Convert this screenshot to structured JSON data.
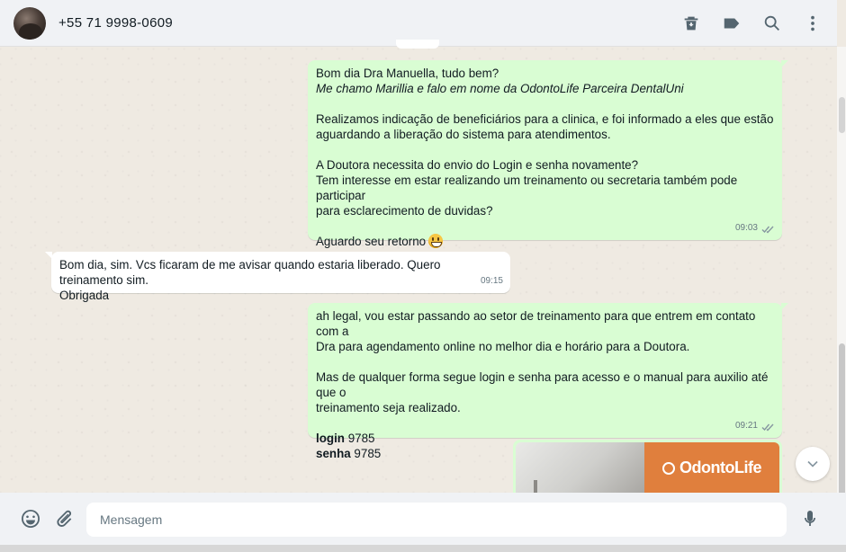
{
  "header": {
    "contact_name": "+55 71 9998-0609",
    "icons": [
      "delete-icon",
      "label-icon",
      "search-icon",
      "menu-icon"
    ]
  },
  "messages": [
    {
      "direction": "outgoing",
      "lines": [
        "Bom dia Dra Manuella, tudo bem?",
        "Me chamo Marillia e falo em nome da OdontoLife Parceira DentalUni",
        "",
        "Realizamos indicação de beneficiários para a clinica, e foi informado a eles que estão",
        "aguardando a liberação do sistema para atendimentos.",
        "",
        "A Doutora necessita do envio do Login e senha novamente?",
        "Tem interesse em estar realizando um treinamento ou secretaria também pode participar",
        "para esclarecimento de duvidas?",
        "",
        "Aguardo seu retorno"
      ],
      "time": "09:03"
    },
    {
      "direction": "incoming",
      "lines": [
        "Bom dia, sim. Vcs ficaram de me avisar quando estaria liberado. Quero treinamento sim.",
        "Obrigada"
      ],
      "time": "09:15"
    },
    {
      "direction": "outgoing",
      "lines": [
        "ah legal, vou estar passando ao setor de treinamento para que entrem em contato com a",
        "Dra para agendamento online no melhor dia e horário para a Doutora.",
        "",
        "Mas de qualquer forma segue login e senha para acesso e o manual para auxilio até que o",
        "treinamento seja realizado.",
        ""
      ],
      "login_label": "login",
      "login_value": " 9785",
      "senha_label": "senha",
      "senha_value": " 9785",
      "time": "09:21"
    }
  ],
  "image_message": {
    "logo_text": "OdontoLife",
    "brand_color": "#e07f3d"
  },
  "footer": {
    "placeholder": "Mensagem",
    "icons": [
      "emoji-icon",
      "attach-icon",
      "microphone-icon"
    ]
  },
  "colors": {
    "outgoing_bubble": "#d9fdd3",
    "incoming_bubble": "#ffffff",
    "chat_background": "#efeae2",
    "icon_color": "#54656f"
  }
}
